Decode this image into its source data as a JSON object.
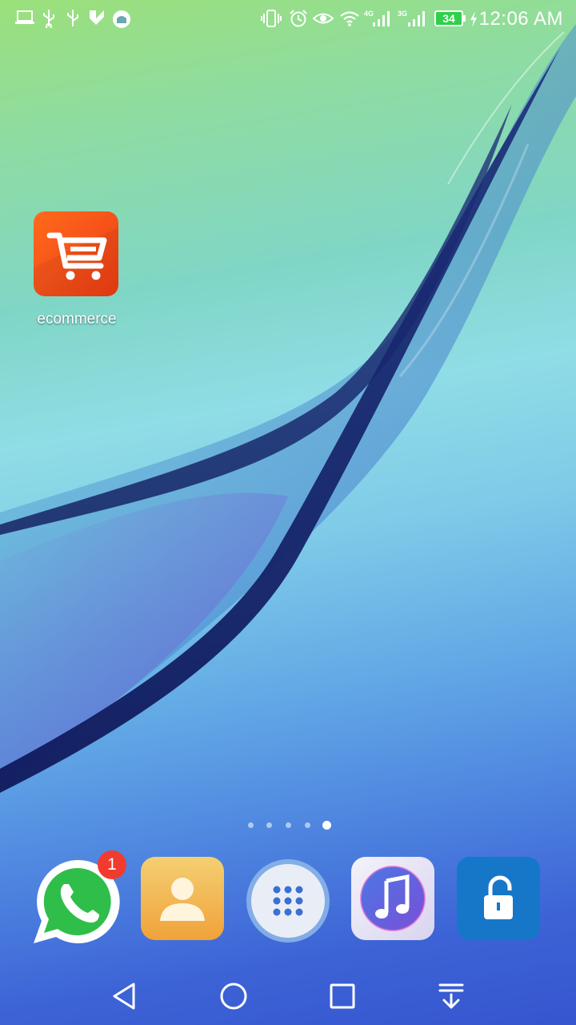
{
  "status_bar": {
    "time": "12:06 AM",
    "battery_level": "34",
    "network_1": "4G",
    "network_2": "3G",
    "left_icons": [
      "laptop-icon",
      "usb-icon",
      "usb-icon",
      "checkmark-app-icon",
      "mosque-app-icon"
    ],
    "right_icons": [
      "vibrate-icon",
      "alarm-icon",
      "eye-icon",
      "wifi-icon",
      "signal-icon",
      "signal-icon",
      "charging-icon"
    ]
  },
  "home": {
    "apps": [
      {
        "label": "ecommerce",
        "icon": "shopping-cart-icon",
        "color": "#f5501a"
      }
    ]
  },
  "page_indicator": {
    "pages": 5,
    "active_index": 4
  },
  "dock": {
    "apps": [
      {
        "icon": "whatsapp-icon",
        "badge": "1"
      },
      {
        "icon": "contacts-icon"
      },
      {
        "icon": "app-drawer-icon"
      },
      {
        "icon": "music-icon"
      },
      {
        "icon": "app-lock-icon"
      }
    ]
  },
  "nav_bar": {
    "buttons": [
      "back-icon",
      "home-icon",
      "recents-icon",
      "notification-pulldown-icon"
    ]
  }
}
